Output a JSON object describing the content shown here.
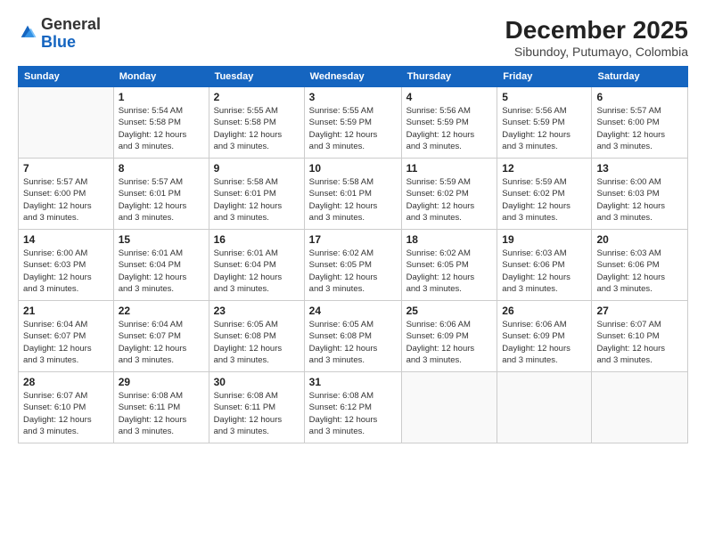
{
  "logo": {
    "general": "General",
    "blue": "Blue"
  },
  "header": {
    "month": "December 2025",
    "location": "Sibundoy, Putumayo, Colombia"
  },
  "weekdays": [
    "Sunday",
    "Monday",
    "Tuesday",
    "Wednesday",
    "Thursday",
    "Friday",
    "Saturday"
  ],
  "weeks": [
    [
      {
        "day": "",
        "info": ""
      },
      {
        "day": "1",
        "info": "Sunrise: 5:54 AM\nSunset: 5:58 PM\nDaylight: 12 hours\nand 3 minutes."
      },
      {
        "day": "2",
        "info": "Sunrise: 5:55 AM\nSunset: 5:58 PM\nDaylight: 12 hours\nand 3 minutes."
      },
      {
        "day": "3",
        "info": "Sunrise: 5:55 AM\nSunset: 5:59 PM\nDaylight: 12 hours\nand 3 minutes."
      },
      {
        "day": "4",
        "info": "Sunrise: 5:56 AM\nSunset: 5:59 PM\nDaylight: 12 hours\nand 3 minutes."
      },
      {
        "day": "5",
        "info": "Sunrise: 5:56 AM\nSunset: 5:59 PM\nDaylight: 12 hours\nand 3 minutes."
      },
      {
        "day": "6",
        "info": "Sunrise: 5:57 AM\nSunset: 6:00 PM\nDaylight: 12 hours\nand 3 minutes."
      }
    ],
    [
      {
        "day": "7",
        "info": "Sunrise: 5:57 AM\nSunset: 6:00 PM\nDaylight: 12 hours\nand 3 minutes."
      },
      {
        "day": "8",
        "info": "Sunrise: 5:57 AM\nSunset: 6:01 PM\nDaylight: 12 hours\nand 3 minutes."
      },
      {
        "day": "9",
        "info": "Sunrise: 5:58 AM\nSunset: 6:01 PM\nDaylight: 12 hours\nand 3 minutes."
      },
      {
        "day": "10",
        "info": "Sunrise: 5:58 AM\nSunset: 6:01 PM\nDaylight: 12 hours\nand 3 minutes."
      },
      {
        "day": "11",
        "info": "Sunrise: 5:59 AM\nSunset: 6:02 PM\nDaylight: 12 hours\nand 3 minutes."
      },
      {
        "day": "12",
        "info": "Sunrise: 5:59 AM\nSunset: 6:02 PM\nDaylight: 12 hours\nand 3 minutes."
      },
      {
        "day": "13",
        "info": "Sunrise: 6:00 AM\nSunset: 6:03 PM\nDaylight: 12 hours\nand 3 minutes."
      }
    ],
    [
      {
        "day": "14",
        "info": "Sunrise: 6:00 AM\nSunset: 6:03 PM\nDaylight: 12 hours\nand 3 minutes."
      },
      {
        "day": "15",
        "info": "Sunrise: 6:01 AM\nSunset: 6:04 PM\nDaylight: 12 hours\nand 3 minutes."
      },
      {
        "day": "16",
        "info": "Sunrise: 6:01 AM\nSunset: 6:04 PM\nDaylight: 12 hours\nand 3 minutes."
      },
      {
        "day": "17",
        "info": "Sunrise: 6:02 AM\nSunset: 6:05 PM\nDaylight: 12 hours\nand 3 minutes."
      },
      {
        "day": "18",
        "info": "Sunrise: 6:02 AM\nSunset: 6:05 PM\nDaylight: 12 hours\nand 3 minutes."
      },
      {
        "day": "19",
        "info": "Sunrise: 6:03 AM\nSunset: 6:06 PM\nDaylight: 12 hours\nand 3 minutes."
      },
      {
        "day": "20",
        "info": "Sunrise: 6:03 AM\nSunset: 6:06 PM\nDaylight: 12 hours\nand 3 minutes."
      }
    ],
    [
      {
        "day": "21",
        "info": "Sunrise: 6:04 AM\nSunset: 6:07 PM\nDaylight: 12 hours\nand 3 minutes."
      },
      {
        "day": "22",
        "info": "Sunrise: 6:04 AM\nSunset: 6:07 PM\nDaylight: 12 hours\nand 3 minutes."
      },
      {
        "day": "23",
        "info": "Sunrise: 6:05 AM\nSunset: 6:08 PM\nDaylight: 12 hours\nand 3 minutes."
      },
      {
        "day": "24",
        "info": "Sunrise: 6:05 AM\nSunset: 6:08 PM\nDaylight: 12 hours\nand 3 minutes."
      },
      {
        "day": "25",
        "info": "Sunrise: 6:06 AM\nSunset: 6:09 PM\nDaylight: 12 hours\nand 3 minutes."
      },
      {
        "day": "26",
        "info": "Sunrise: 6:06 AM\nSunset: 6:09 PM\nDaylight: 12 hours\nand 3 minutes."
      },
      {
        "day": "27",
        "info": "Sunrise: 6:07 AM\nSunset: 6:10 PM\nDaylight: 12 hours\nand 3 minutes."
      }
    ],
    [
      {
        "day": "28",
        "info": "Sunrise: 6:07 AM\nSunset: 6:10 PM\nDaylight: 12 hours\nand 3 minutes."
      },
      {
        "day": "29",
        "info": "Sunrise: 6:08 AM\nSunset: 6:11 PM\nDaylight: 12 hours\nand 3 minutes."
      },
      {
        "day": "30",
        "info": "Sunrise: 6:08 AM\nSunset: 6:11 PM\nDaylight: 12 hours\nand 3 minutes."
      },
      {
        "day": "31",
        "info": "Sunrise: 6:08 AM\nSunset: 6:12 PM\nDaylight: 12 hours\nand 3 minutes."
      },
      {
        "day": "",
        "info": ""
      },
      {
        "day": "",
        "info": ""
      },
      {
        "day": "",
        "info": ""
      }
    ]
  ]
}
